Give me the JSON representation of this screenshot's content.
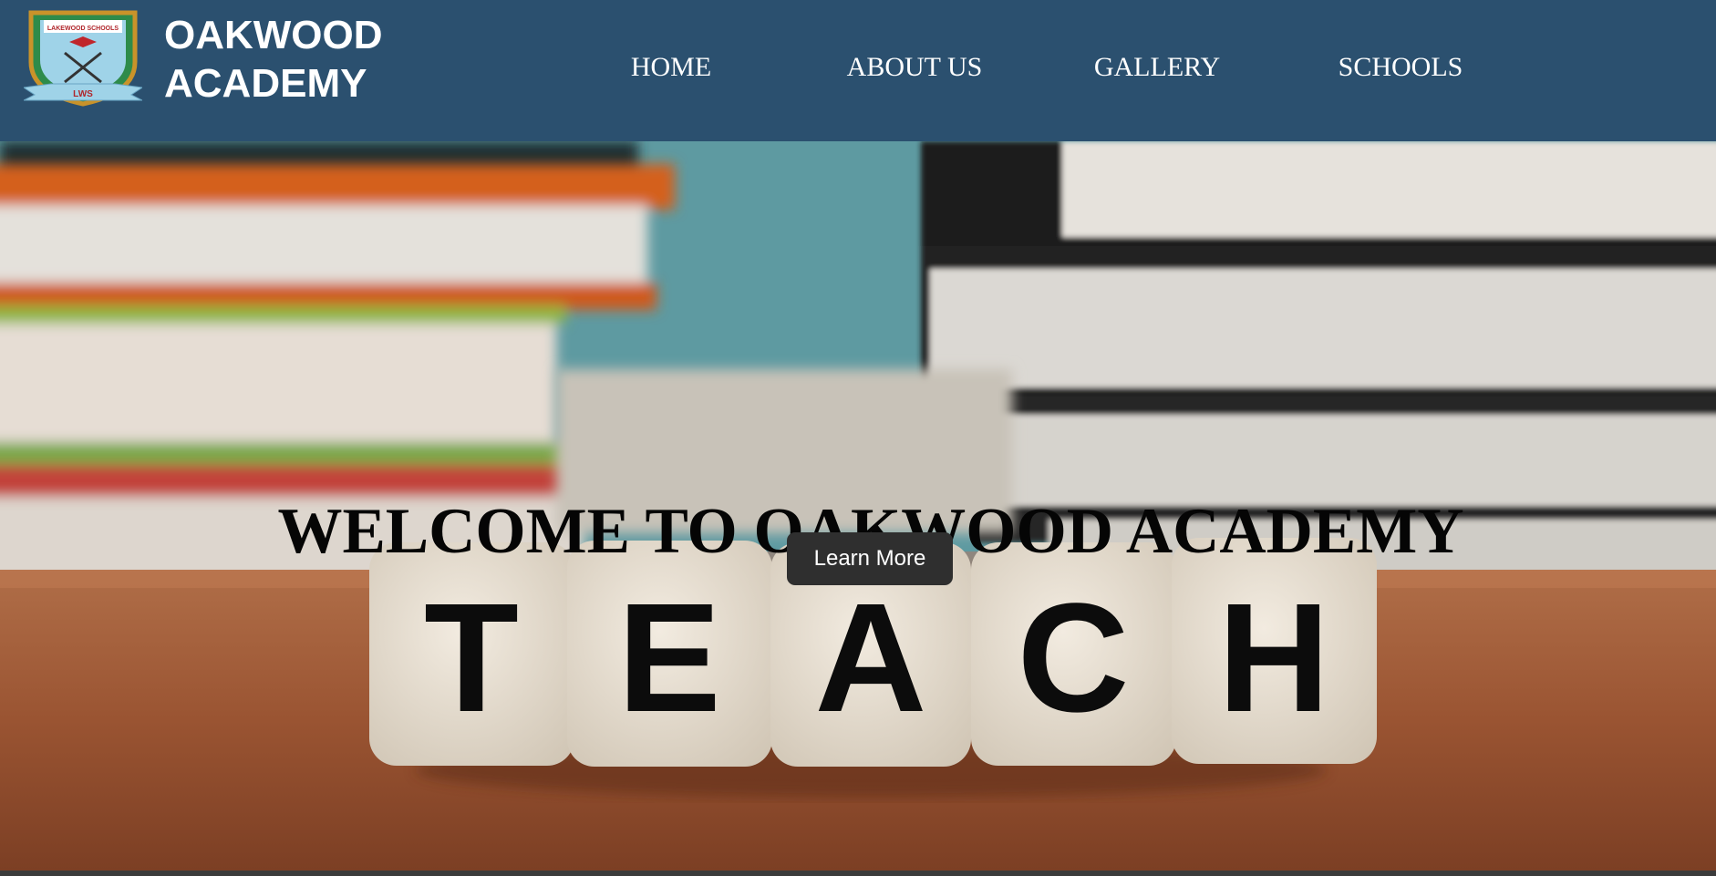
{
  "header": {
    "logo": {
      "icon": "school-crest-icon",
      "banner_text": "LAKEWOOD SCHOOLS",
      "ribbon_text": "LWS"
    },
    "brand_line1": "OAKWOOD",
    "brand_line2": "ACADEMY",
    "nav": [
      {
        "label": "HOME"
      },
      {
        "label": "ABOUT US"
      },
      {
        "label": "GALLERY"
      },
      {
        "label": "SCHOOLS"
      }
    ]
  },
  "hero": {
    "title": "WELCOME TO OAKWOOD ACADEMY",
    "button_label": "Learn More",
    "dice_letters": [
      "T",
      "E",
      "A",
      "C",
      "H"
    ]
  },
  "colors": {
    "header_bg": "#2b506f",
    "button_bg": "#2f2f2f",
    "text_light": "#ffffff"
  }
}
